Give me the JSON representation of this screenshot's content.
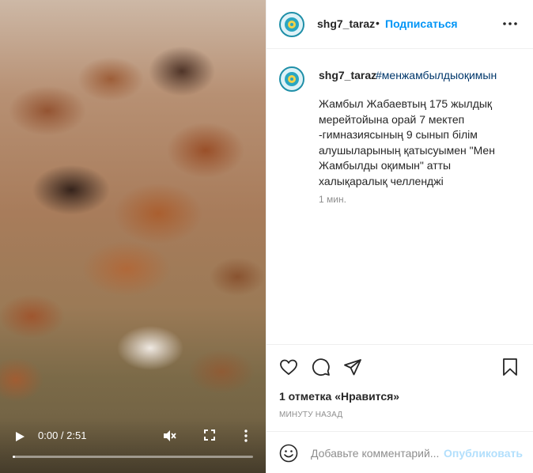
{
  "video": {
    "time": "0:00 / 2:51",
    "progress_fraction": 0.0
  },
  "header": {
    "username": "shg7_taraz",
    "separator": "•",
    "follow_label": "Подписаться"
  },
  "caption": {
    "username": "shg7_taraz",
    "hashtag": "#менжамбылдыоқимын",
    "text": "Жамбыл Жабаевтың 175 жылдық\nмерейтойына орай 7 мектеп\n-гимназиясының 9 сынып білім\nалушыларының қатысуымен \"Мен\nЖамбылды оқимын\" атты\nхалықаралық челленджі",
    "time": "1 мин."
  },
  "actions": {
    "likes": "1 отметка «Нравится»",
    "ago": "МИНУТУ НАЗАД"
  },
  "comment": {
    "placeholder": "Добавьте комментарий...",
    "publish_label": "Опубликовать"
  },
  "colors": {
    "accent": "#0095f6",
    "link": "#00376b",
    "muted": "#8e8e8e",
    "publish_disabled": "#b2dffc",
    "avatar_ring": "#1f8fa8"
  },
  "icons": [
    "play-icon",
    "mute-icon",
    "fullscreen-icon",
    "more-vertical-icon",
    "more-horizontal-icon",
    "heart-icon",
    "comment-icon",
    "share-icon",
    "bookmark-icon",
    "emoji-icon"
  ]
}
